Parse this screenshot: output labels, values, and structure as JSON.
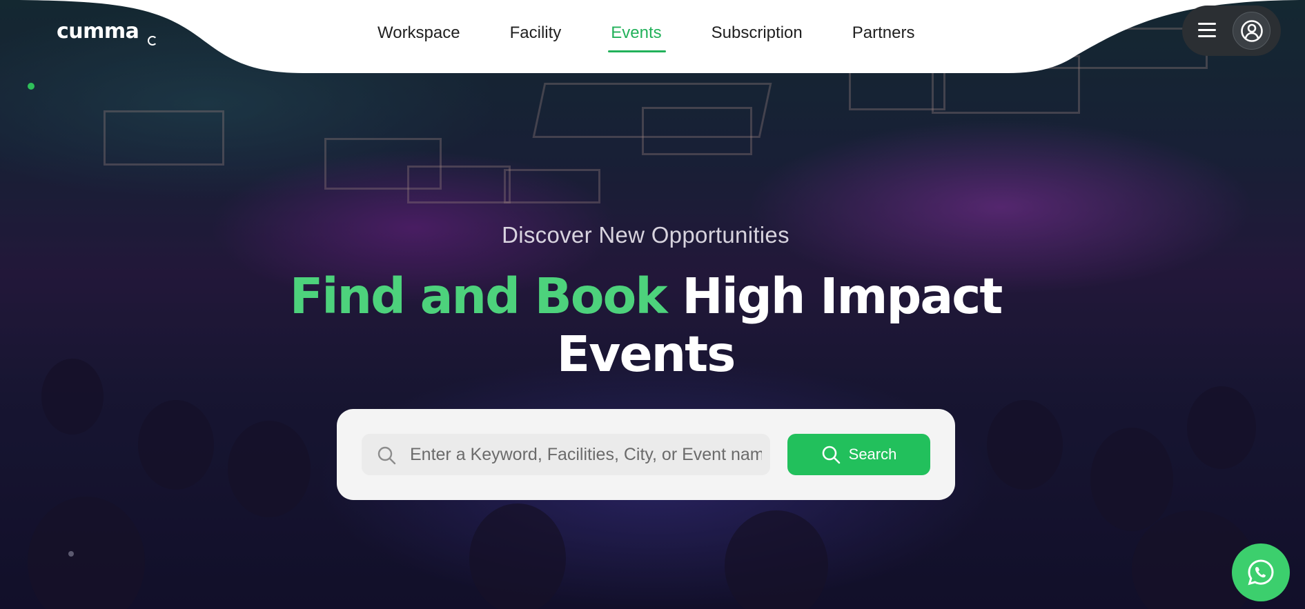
{
  "brand": {
    "logo_text": "cumma",
    "accent_color": "#22c05c"
  },
  "nav": {
    "items": [
      {
        "label": "Workspace",
        "active": false
      },
      {
        "label": "Facility",
        "active": false
      },
      {
        "label": "Events",
        "active": true
      },
      {
        "label": "Subscription",
        "active": false
      },
      {
        "label": "Partners",
        "active": false
      }
    ]
  },
  "header_actions": {
    "menu_icon": "hamburger-menu-icon",
    "account_icon": "user-circle-icon"
  },
  "hero": {
    "subtitle": "Discover New Opportunities",
    "headline_highlight": "Find and Book",
    "headline_rest": "High Impact",
    "headline_line2": "Events",
    "highlight_color": "#4dd27c"
  },
  "search": {
    "placeholder": "Enter a Keyword, Facilities, City, or Event nam",
    "value": "",
    "button_label": "Search",
    "icon": "search-icon"
  },
  "floating": {
    "icon": "whatsapp-icon",
    "color": "#3ccf6d"
  }
}
